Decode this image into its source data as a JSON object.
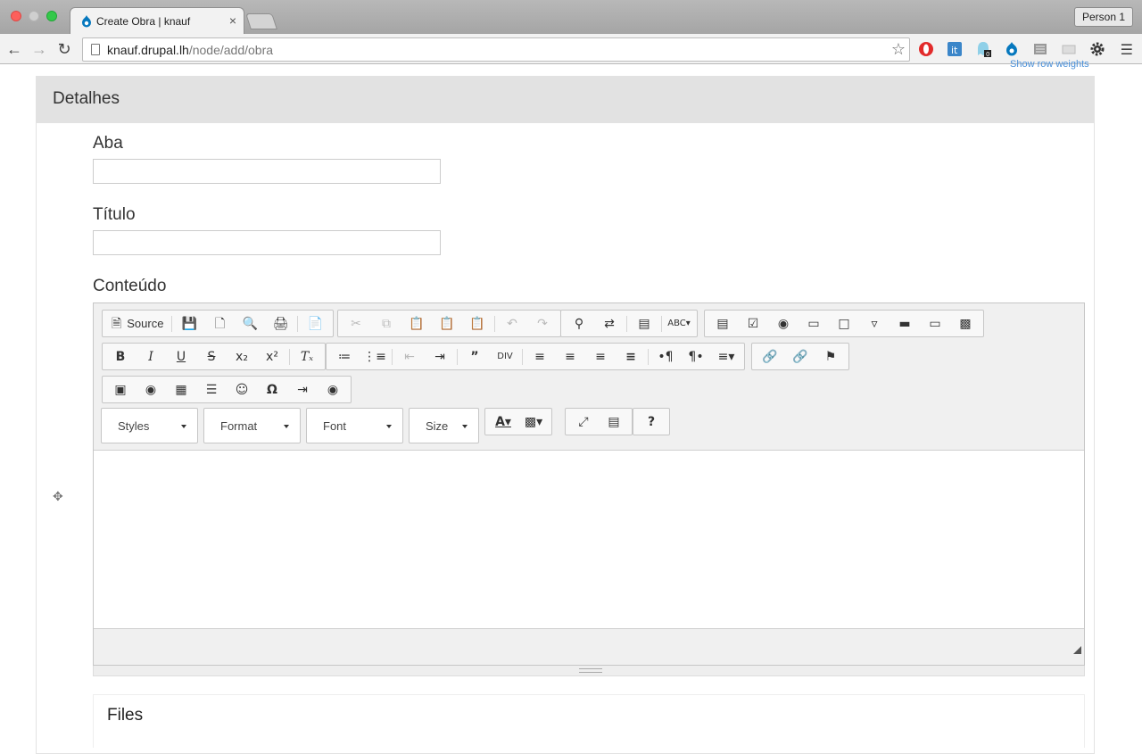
{
  "browser": {
    "tab_title": "Create Obra | knauf",
    "tab_close": "×",
    "url_host": "knauf.drupal.lh",
    "url_path": "/node/add/obra",
    "profile": "Person 1"
  },
  "page": {
    "show_row_weights": "Show row weights",
    "panel_title": "Detalhes",
    "fields": {
      "aba_label": "Aba",
      "aba_value": "",
      "titulo_label": "Título",
      "titulo_value": "",
      "conteudo_label": "Conteúdo"
    },
    "editor": {
      "source_label": "Source",
      "combos": {
        "styles": "Styles",
        "format": "Format",
        "font": "Font",
        "size": "Size"
      },
      "help_label": "?"
    },
    "files_title": "Files"
  },
  "colors": {
    "link": "#4a90d9",
    "panel_header_bg": "#e2e2e2",
    "editor_toolbar_bg": "#f0f0f0"
  }
}
